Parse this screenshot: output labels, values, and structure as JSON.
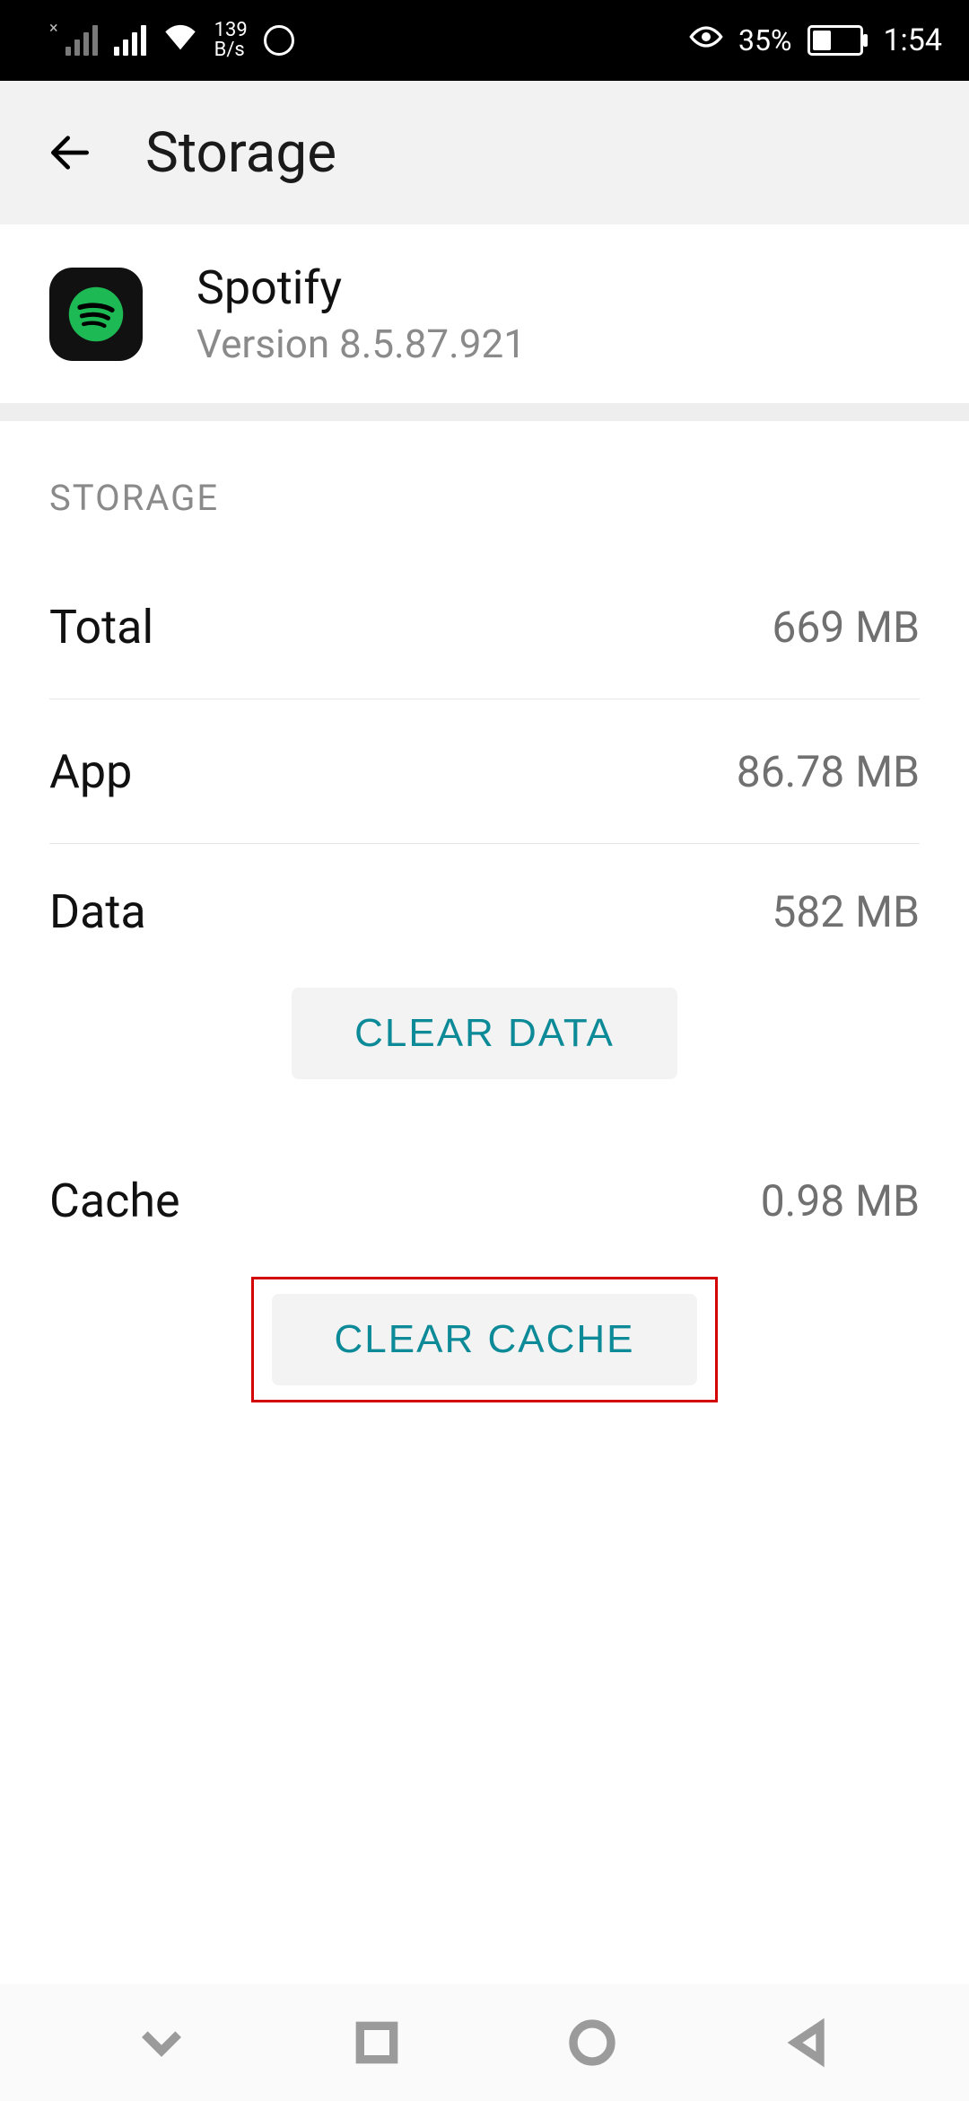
{
  "statusbar": {
    "netspeed_top": "139",
    "netspeed_bottom": "B/s",
    "battery_percent": "35%",
    "time": "1:54"
  },
  "appbar": {
    "title": "Storage"
  },
  "app": {
    "name": "Spotify",
    "version": "Version 8.5.87.921"
  },
  "storage": {
    "section_title": "STORAGE",
    "rows": {
      "total": {
        "label": "Total",
        "value": "669 MB"
      },
      "app": {
        "label": "App",
        "value": "86.78 MB"
      },
      "data": {
        "label": "Data",
        "value": "582 MB"
      },
      "cache": {
        "label": "Cache",
        "value": "0.98 MB"
      }
    },
    "buttons": {
      "clear_data": "CLEAR DATA",
      "clear_cache": "CLEAR CACHE"
    }
  }
}
